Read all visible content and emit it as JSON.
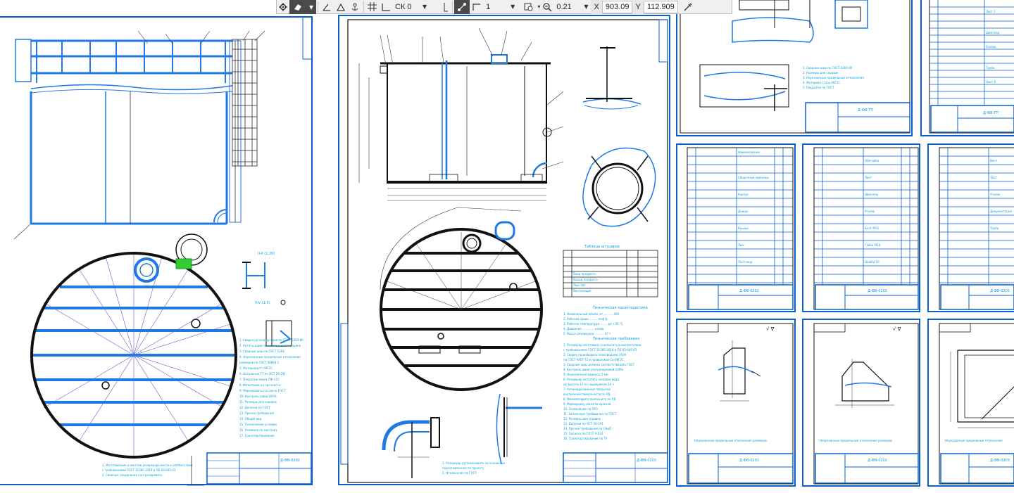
{
  "toolbar": {
    "style_value": "СК 0",
    "scale_value": "1",
    "zoom_value": "0.21",
    "x_label": "X",
    "x_value": "903.09",
    "y_label": "Y",
    "y_value": "112.909",
    "icons": [
      "gear-icon",
      "eraser-icon",
      "dropdown-icon",
      "angle-snap-icon",
      "triangle-snap-icon",
      "anchor-icon",
      "grid-icon",
      "coordinate-system-icon",
      "pen-icon",
      "snap-icon",
      "dimension-icon",
      "view-icon",
      "zoom-icon",
      "eyedropper-icon"
    ]
  },
  "sheet_stamps": {
    "sheet1": "Д-ФВ-0202",
    "sheet2": "Д-ФВ-0203",
    "sheet3": "Д-ФВ-ТП",
    "sheet4": "Д-ФВ-ТП",
    "spec1": "Д-ФВ-0202",
    "spec2": "Д-ФВ-0202",
    "spec3": "Д-ФВ-0202",
    "detail1": "Д-ФВ-0201",
    "detail2": "Д-ФВ-0202",
    "detail3": "Д-ФВ-0203"
  },
  "annotations": {
    "section_ii": "II-II (1:20)",
    "section_v": "V-V (1:5)",
    "tech_req_title": "Технические требования",
    "tech_char_title": "Техническая характеристика",
    "table_title": "Таблица штуцеров"
  },
  "colors": {
    "paper": "#ffffff",
    "frame": "#0078d7",
    "geometry": "#1e78e6",
    "dark_line": "#1a1a1a",
    "text_cyan": "#00a0e0",
    "construction": "#7b52c9",
    "highlight": "#33cc33"
  }
}
